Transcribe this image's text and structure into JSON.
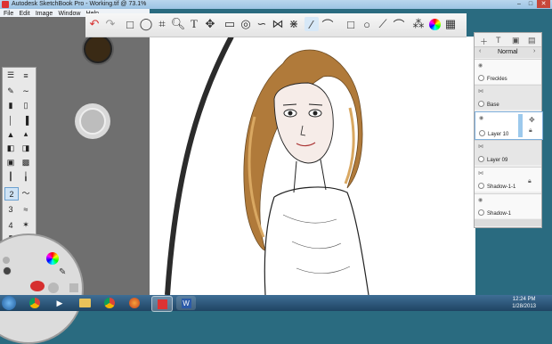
{
  "window": {
    "title": "Autodesk SketchBook Pro - Working.tif @ 73.1%",
    "minimize": "–",
    "maximize": "□",
    "close": "✕"
  },
  "menu": [
    "File",
    "Edit",
    "Image",
    "Window",
    "Help"
  ],
  "toolbar": {
    "icons": [
      "undo-icon",
      "redo-icon",
      "rect-select-icon",
      "lasso-icon",
      "crop-icon",
      "zoom-icon",
      "text-icon",
      "move-icon",
      "ruler-icon",
      "ellipse-guide-icon",
      "french-curve-icon",
      "symmetry-x-icon",
      "symmetry-y-icon",
      "perspective-icon",
      "pen-line-icon",
      "curve-icon",
      "rectangle-icon",
      "ellipse-icon",
      "polyline-icon",
      "arc-icon",
      "copic-colors-icon",
      "color-wheel-icon",
      "brush-palette-icon",
      "layer-editor-icon"
    ],
    "text_tool_label": "T"
  },
  "layers": {
    "blend_mode": "Normal",
    "items": [
      {
        "name": "Freckles"
      },
      {
        "name": "Base"
      },
      {
        "name": "Layer 10",
        "selected": true
      },
      {
        "name": "Layer 09"
      },
      {
        "name": "Shadow-1-1"
      },
      {
        "name": "Shadow-1"
      }
    ]
  },
  "brushpalette": {
    "sizes": [
      "2",
      "3",
      "4"
    ]
  },
  "taskbar": {
    "time": "12:24 PM",
    "date": "1/28/2013",
    "apps": [
      "start-orb-icon",
      "chrome-icon",
      "media-player-icon",
      "explorer-icon",
      "chrome-icon",
      "firefox-icon",
      "sketchbook-icon",
      "word-icon"
    ]
  },
  "colors": {
    "accent": "#d62f2f",
    "puck_color": "#3a2a15",
    "canvas": "#ffffff",
    "panel_grey": "#6f6f6f",
    "hair": "#b07a3a"
  }
}
